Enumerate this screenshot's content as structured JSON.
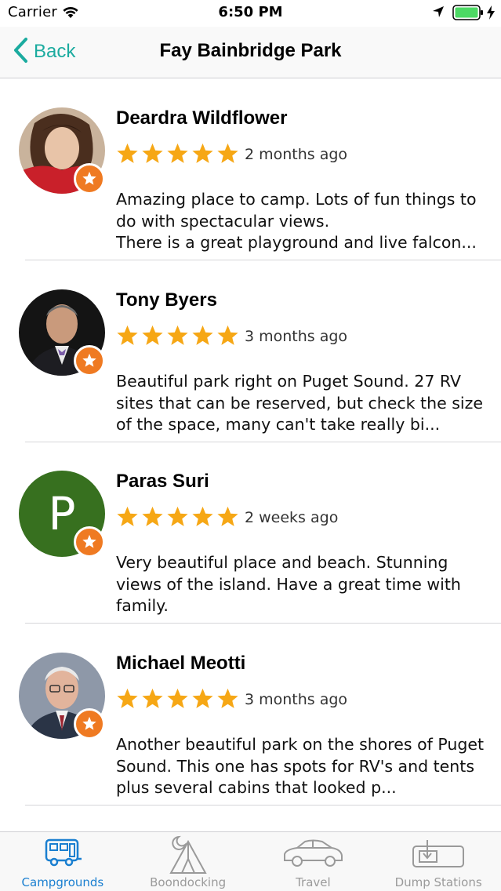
{
  "status_bar": {
    "carrier": "Carrier",
    "time": "6:50 PM",
    "battery_color": "#4cd964"
  },
  "nav": {
    "back_label": "Back",
    "title": "Fay Bainbridge Park",
    "accent_color": "#1bab9f"
  },
  "reviews": [
    {
      "name": "Deardra Wildflower",
      "rating": 5,
      "time": "2 months ago",
      "text": "Amazing place to camp. Lots of fun things to do with spectacular views.\nThere is a great playground and live falcon..."
    },
    {
      "name": "Tony Byers",
      "rating": 5,
      "time": "3 months ago",
      "text": "Beautiful park right on Puget Sound. 27 RV sites that can be reserved, but check the size of the space, many can't take really bi..."
    },
    {
      "name": "Paras Suri",
      "avatar_letter": "P",
      "rating": 5,
      "time": "2 weeks ago",
      "text": "Very beautiful place and beach. Stunning views of the island. Have a great time with family."
    },
    {
      "name": "Michael Meotti",
      "rating": 5,
      "time": "3 months ago",
      "text": "Another beautiful park on the shores of Puget Sound.  This one has spots for RV's and tents plus several cabins that looked p..."
    }
  ],
  "tabs": [
    {
      "label": "Campgrounds",
      "icon": "rv-icon",
      "active": true
    },
    {
      "label": "Boondocking",
      "icon": "tent-moon-icon",
      "active": false
    },
    {
      "label": "Travel",
      "icon": "car-icon",
      "active": false
    },
    {
      "label": "Dump Stations",
      "icon": "dump-station-icon",
      "active": false
    }
  ],
  "colors": {
    "star": "#f6a715",
    "badge": "#ef7a22",
    "tab_active": "#1a7fd0",
    "tab_inactive": "#9a9a9a"
  }
}
